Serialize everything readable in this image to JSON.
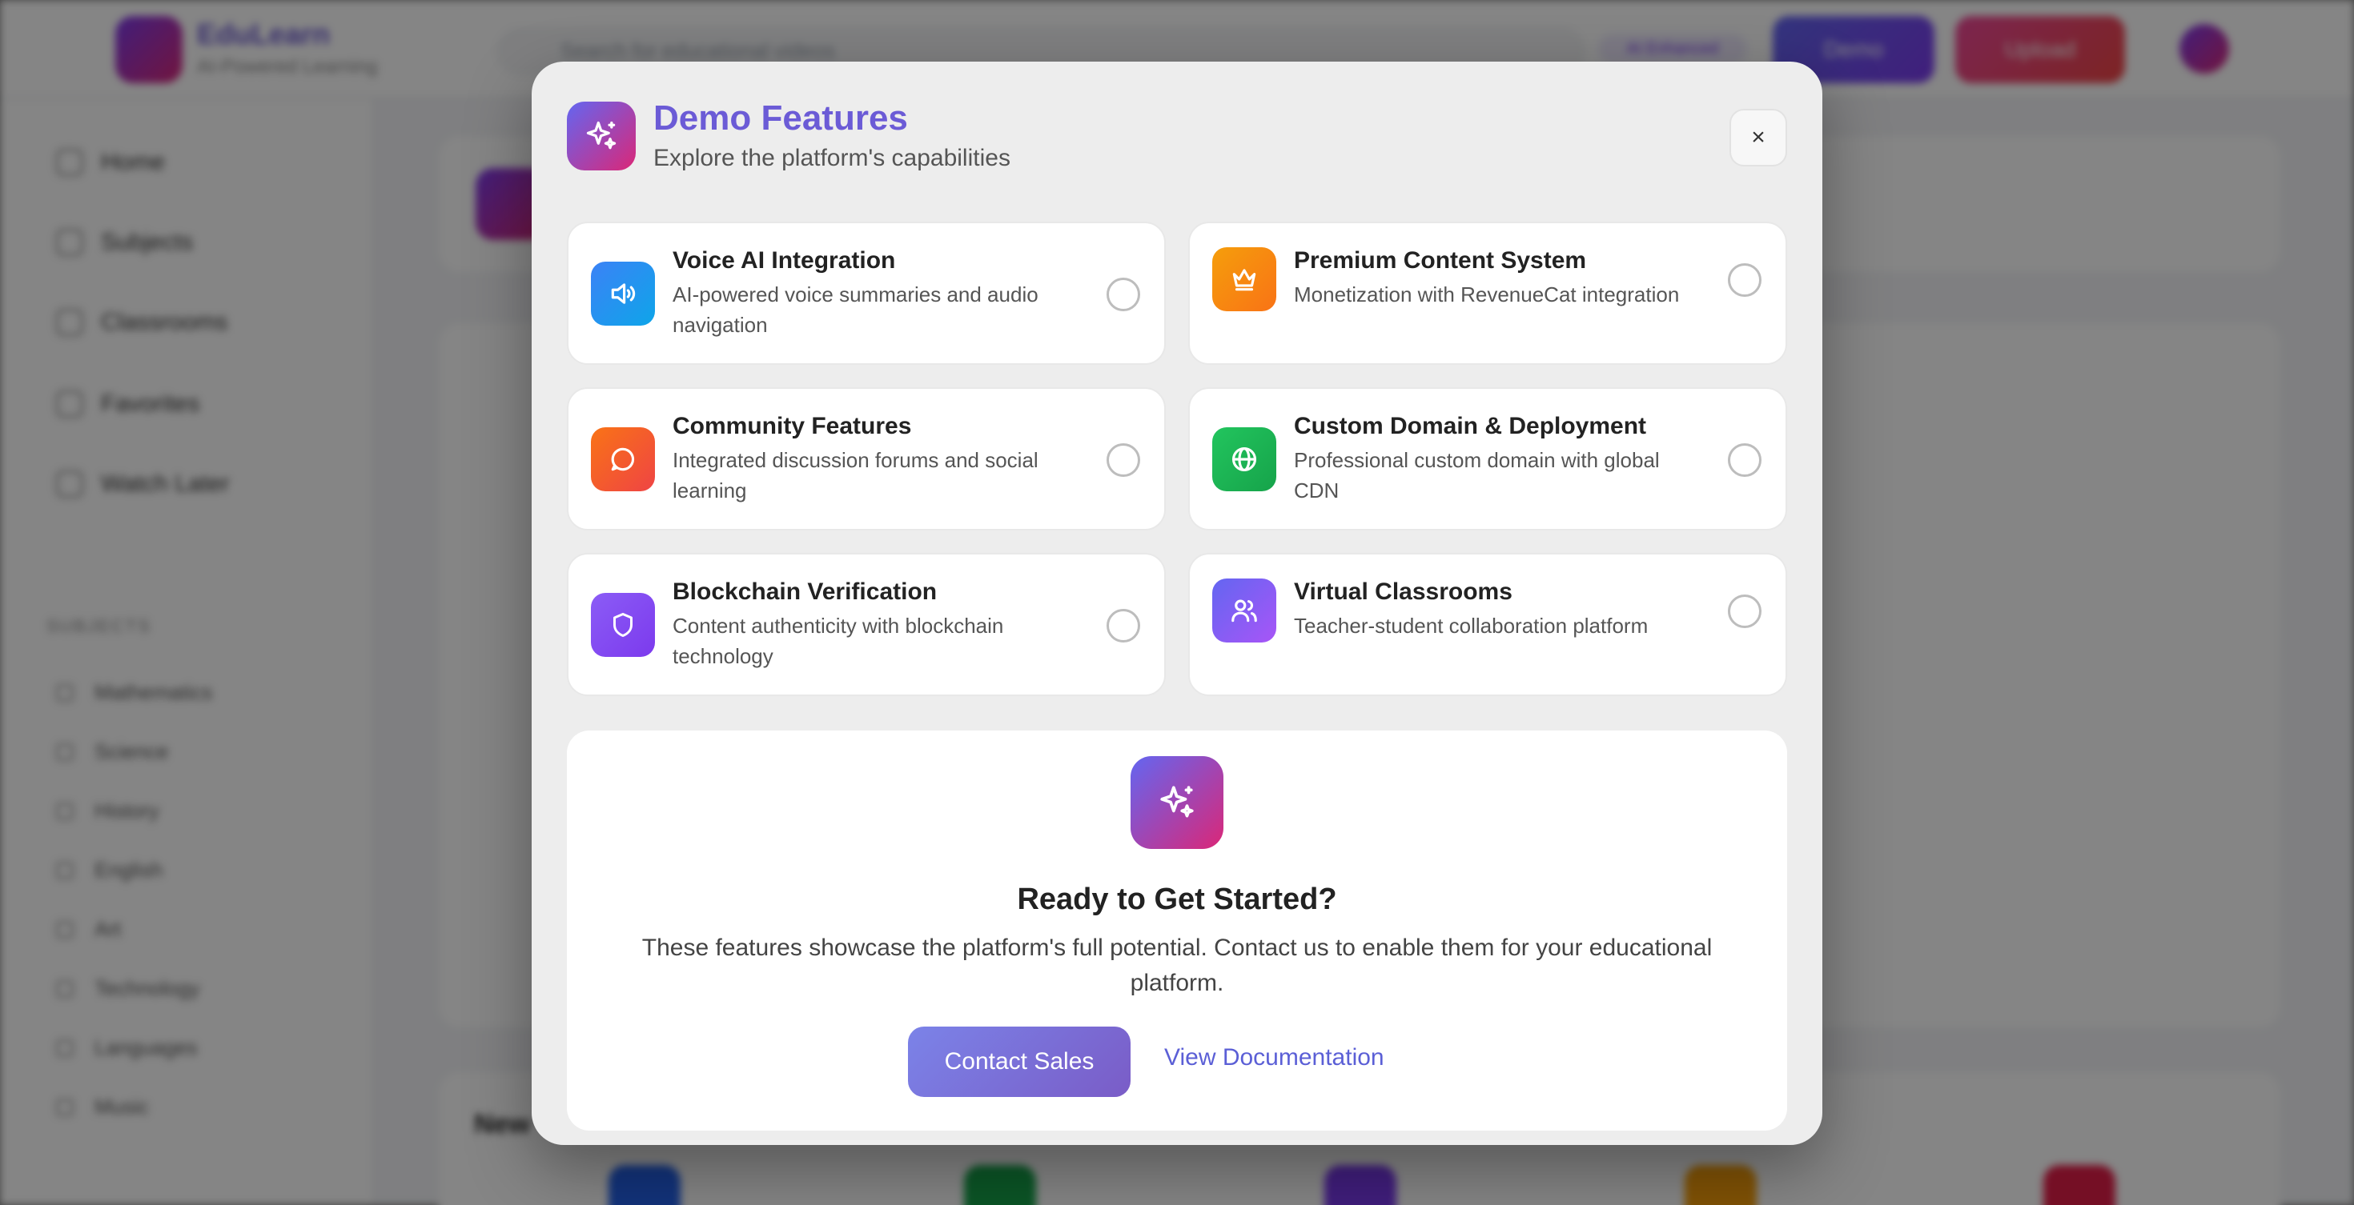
{
  "background": {
    "brand": "EduLearn",
    "tagline": "AI-Powered Learning",
    "search_placeholder": "Search for educational videos",
    "badge": "AI Enhanced",
    "demo_button": "Demo",
    "upload_button": "Upload",
    "nav": [
      "Home",
      "Subjects",
      "Classrooms",
      "Favorites",
      "Watch Later"
    ],
    "subjects_heading": "SUBJECTS",
    "subjects": [
      "Mathematics",
      "Science",
      "History",
      "English",
      "Art",
      "Technology",
      "Languages",
      "Music"
    ],
    "section_title": "New"
  },
  "modal": {
    "title": "Demo Features",
    "subtitle": "Explore the platform's capabilities",
    "close_label": "×",
    "features": [
      {
        "name": "Voice AI Integration",
        "description": "AI-powered voice summaries and audio navigation",
        "icon": "speaker-icon",
        "color": "#1d9be6"
      },
      {
        "name": "Premium Content System",
        "description": "Monetization with RevenueCat integration",
        "icon": "crown-icon",
        "color": "#f59e0b"
      },
      {
        "name": "Community Features",
        "description": "Integrated discussion forums and social learning",
        "icon": "chat-bubble-icon",
        "color": "#f4511e"
      },
      {
        "name": "Custom Domain & Deployment",
        "description": "Professional custom domain with global CDN",
        "icon": "globe-icon",
        "color": "#16a34a"
      },
      {
        "name": "Blockchain Verification",
        "description": "Content authenticity with blockchain technology",
        "icon": "shield-icon",
        "color": "#7c3aed"
      },
      {
        "name": "Virtual Classrooms",
        "description": "Teacher-student collaboration platform",
        "icon": "users-icon",
        "color": "#7c4dff"
      }
    ],
    "cta": {
      "title": "Ready to Get Started?",
      "text": "These features showcase the platform's full potential. Contact us to enable them for your educational platform.",
      "primary": "Contact Sales",
      "secondary": "View Documentation"
    }
  },
  "colors": {
    "accent": "#6b5bd6",
    "link": "#5b5fd6",
    "gradient_start": "#6366f1",
    "gradient_end": "#db2777"
  }
}
